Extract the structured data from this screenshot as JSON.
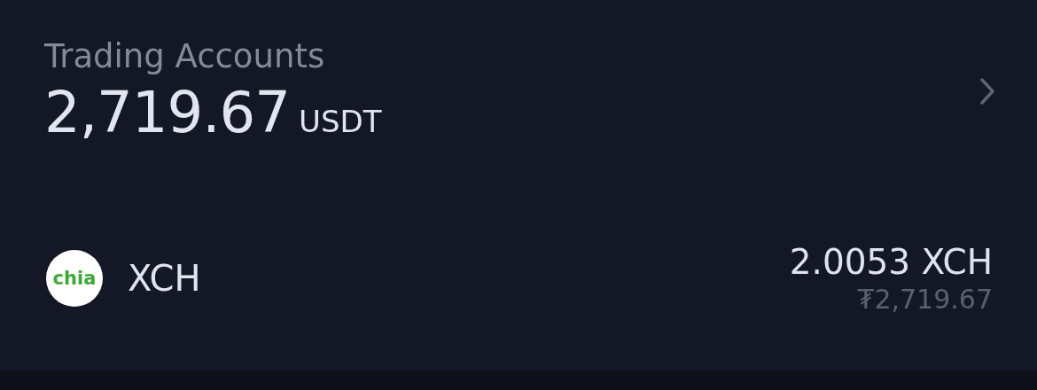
{
  "section": {
    "title": "Trading Accounts",
    "balance": "2,719.67",
    "unit": "USDT"
  },
  "assets": [
    {
      "logo_text": "chia",
      "symbol": "XCH",
      "amount": "2.0053 XCH",
      "fiat": "₮2,719.67"
    }
  ]
}
